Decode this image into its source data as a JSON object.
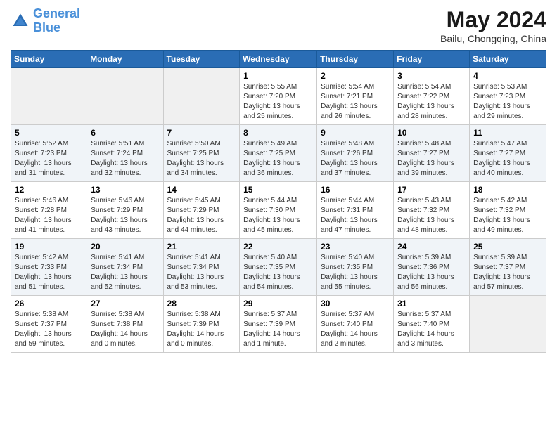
{
  "header": {
    "logo_line1": "General",
    "logo_line2": "Blue",
    "month": "May 2024",
    "location": "Bailu, Chongqing, China"
  },
  "days_of_week": [
    "Sunday",
    "Monday",
    "Tuesday",
    "Wednesday",
    "Thursday",
    "Friday",
    "Saturday"
  ],
  "weeks": [
    [
      {
        "day": "",
        "info": ""
      },
      {
        "day": "",
        "info": ""
      },
      {
        "day": "",
        "info": ""
      },
      {
        "day": "1",
        "info": "Sunrise: 5:55 AM\nSunset: 7:20 PM\nDaylight: 13 hours\nand 25 minutes."
      },
      {
        "day": "2",
        "info": "Sunrise: 5:54 AM\nSunset: 7:21 PM\nDaylight: 13 hours\nand 26 minutes."
      },
      {
        "day": "3",
        "info": "Sunrise: 5:54 AM\nSunset: 7:22 PM\nDaylight: 13 hours\nand 28 minutes."
      },
      {
        "day": "4",
        "info": "Sunrise: 5:53 AM\nSunset: 7:23 PM\nDaylight: 13 hours\nand 29 minutes."
      }
    ],
    [
      {
        "day": "5",
        "info": "Sunrise: 5:52 AM\nSunset: 7:23 PM\nDaylight: 13 hours\nand 31 minutes."
      },
      {
        "day": "6",
        "info": "Sunrise: 5:51 AM\nSunset: 7:24 PM\nDaylight: 13 hours\nand 32 minutes."
      },
      {
        "day": "7",
        "info": "Sunrise: 5:50 AM\nSunset: 7:25 PM\nDaylight: 13 hours\nand 34 minutes."
      },
      {
        "day": "8",
        "info": "Sunrise: 5:49 AM\nSunset: 7:25 PM\nDaylight: 13 hours\nand 36 minutes."
      },
      {
        "day": "9",
        "info": "Sunrise: 5:48 AM\nSunset: 7:26 PM\nDaylight: 13 hours\nand 37 minutes."
      },
      {
        "day": "10",
        "info": "Sunrise: 5:48 AM\nSunset: 7:27 PM\nDaylight: 13 hours\nand 39 minutes."
      },
      {
        "day": "11",
        "info": "Sunrise: 5:47 AM\nSunset: 7:27 PM\nDaylight: 13 hours\nand 40 minutes."
      }
    ],
    [
      {
        "day": "12",
        "info": "Sunrise: 5:46 AM\nSunset: 7:28 PM\nDaylight: 13 hours\nand 41 minutes."
      },
      {
        "day": "13",
        "info": "Sunrise: 5:46 AM\nSunset: 7:29 PM\nDaylight: 13 hours\nand 43 minutes."
      },
      {
        "day": "14",
        "info": "Sunrise: 5:45 AM\nSunset: 7:29 PM\nDaylight: 13 hours\nand 44 minutes."
      },
      {
        "day": "15",
        "info": "Sunrise: 5:44 AM\nSunset: 7:30 PM\nDaylight: 13 hours\nand 45 minutes."
      },
      {
        "day": "16",
        "info": "Sunrise: 5:44 AM\nSunset: 7:31 PM\nDaylight: 13 hours\nand 47 minutes."
      },
      {
        "day": "17",
        "info": "Sunrise: 5:43 AM\nSunset: 7:32 PM\nDaylight: 13 hours\nand 48 minutes."
      },
      {
        "day": "18",
        "info": "Sunrise: 5:42 AM\nSunset: 7:32 PM\nDaylight: 13 hours\nand 49 minutes."
      }
    ],
    [
      {
        "day": "19",
        "info": "Sunrise: 5:42 AM\nSunset: 7:33 PM\nDaylight: 13 hours\nand 51 minutes."
      },
      {
        "day": "20",
        "info": "Sunrise: 5:41 AM\nSunset: 7:34 PM\nDaylight: 13 hours\nand 52 minutes."
      },
      {
        "day": "21",
        "info": "Sunrise: 5:41 AM\nSunset: 7:34 PM\nDaylight: 13 hours\nand 53 minutes."
      },
      {
        "day": "22",
        "info": "Sunrise: 5:40 AM\nSunset: 7:35 PM\nDaylight: 13 hours\nand 54 minutes."
      },
      {
        "day": "23",
        "info": "Sunrise: 5:40 AM\nSunset: 7:35 PM\nDaylight: 13 hours\nand 55 minutes."
      },
      {
        "day": "24",
        "info": "Sunrise: 5:39 AM\nSunset: 7:36 PM\nDaylight: 13 hours\nand 56 minutes."
      },
      {
        "day": "25",
        "info": "Sunrise: 5:39 AM\nSunset: 7:37 PM\nDaylight: 13 hours\nand 57 minutes."
      }
    ],
    [
      {
        "day": "26",
        "info": "Sunrise: 5:38 AM\nSunset: 7:37 PM\nDaylight: 13 hours\nand 59 minutes."
      },
      {
        "day": "27",
        "info": "Sunrise: 5:38 AM\nSunset: 7:38 PM\nDaylight: 14 hours\nand 0 minutes."
      },
      {
        "day": "28",
        "info": "Sunrise: 5:38 AM\nSunset: 7:39 PM\nDaylight: 14 hours\nand 0 minutes."
      },
      {
        "day": "29",
        "info": "Sunrise: 5:37 AM\nSunset: 7:39 PM\nDaylight: 14 hours\nand 1 minute."
      },
      {
        "day": "30",
        "info": "Sunrise: 5:37 AM\nSunset: 7:40 PM\nDaylight: 14 hours\nand 2 minutes."
      },
      {
        "day": "31",
        "info": "Sunrise: 5:37 AM\nSunset: 7:40 PM\nDaylight: 14 hours\nand 3 minutes."
      },
      {
        "day": "",
        "info": ""
      }
    ]
  ]
}
